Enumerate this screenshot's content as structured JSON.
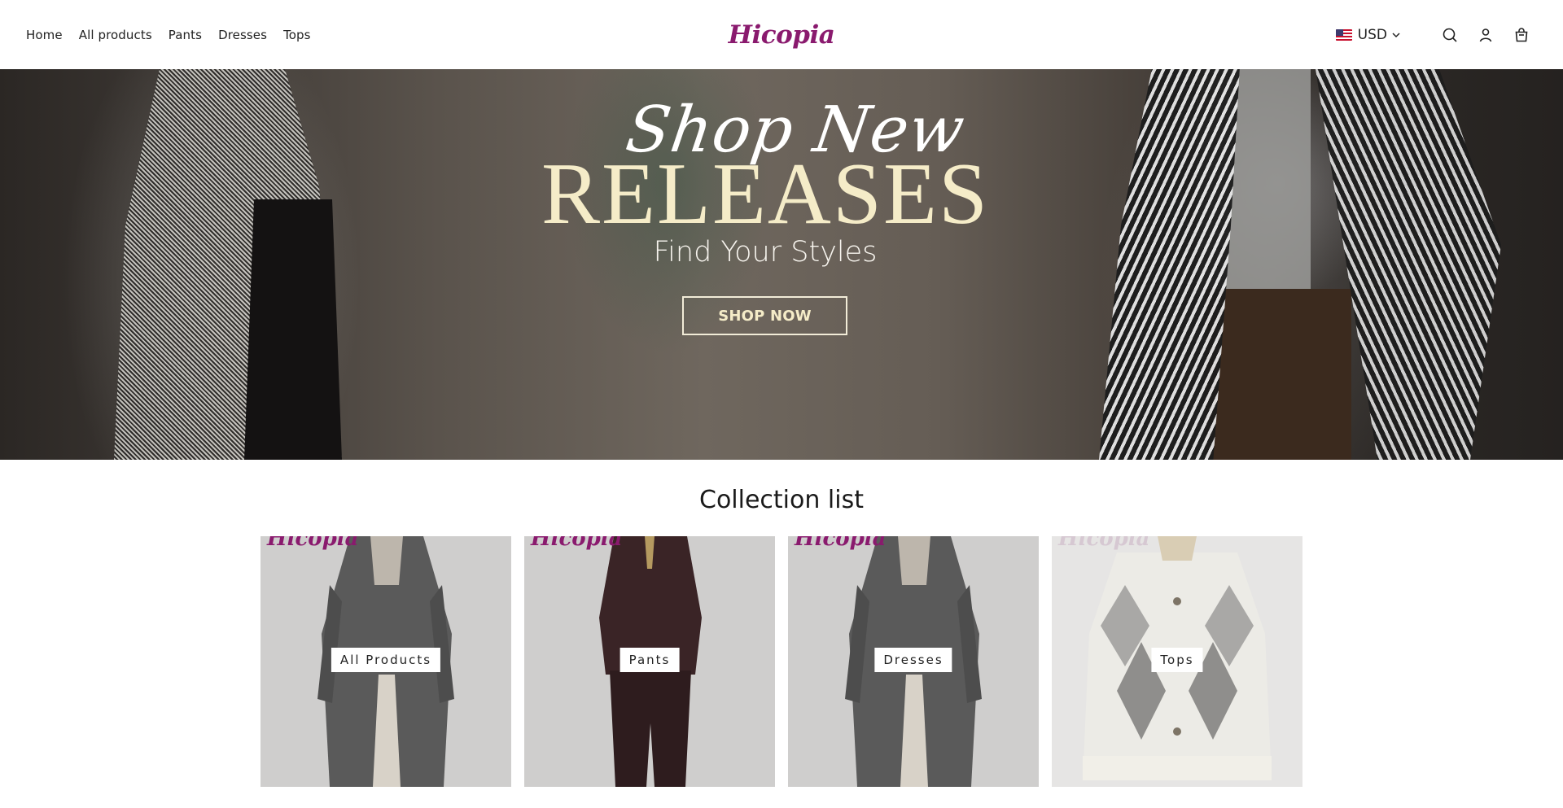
{
  "header": {
    "nav": [
      "Home",
      "All products",
      "Pants",
      "Dresses",
      "Tops"
    ],
    "logo": "Hicopia",
    "currency": "USD"
  },
  "hero": {
    "script_text": "Shop New",
    "headline": "RELEASES",
    "subtitle": "Find Your Styles",
    "cta": "SHOP NOW"
  },
  "collection": {
    "title": "Collection list",
    "watermark": "Hicopia",
    "items": [
      {
        "label": "All Products"
      },
      {
        "label": "Pants"
      },
      {
        "label": "Dresses"
      },
      {
        "label": "Tops"
      }
    ]
  },
  "icons": {
    "search": "search-icon",
    "account": "user-icon",
    "cart": "cart-icon"
  },
  "colors": {
    "brand": "#8a1a6e",
    "hero_headline": "#f5ecc8"
  }
}
